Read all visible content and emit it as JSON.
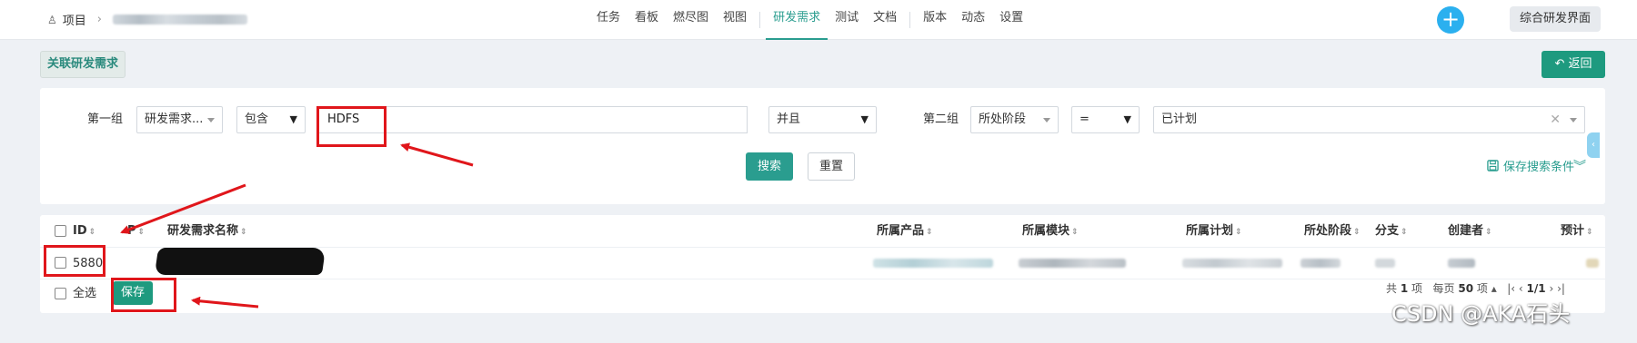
{
  "topnav": {
    "project_label": "项目",
    "items": [
      "任务",
      "看板",
      "燃尽图",
      "视图",
      "研发需求",
      "测试",
      "文档",
      "版本",
      "动态",
      "设置"
    ],
    "active_item": "研发需求",
    "right_button": "综合研发界面"
  },
  "subheader": {
    "tag": "关联研发需求",
    "back_button": "返回"
  },
  "search": {
    "group1_label": "第一组",
    "group1_field": "研发需求...",
    "group1_operator": "包含",
    "group1_value": "HDFS",
    "logic": "并且",
    "group2_label": "第二组",
    "group2_field": "所处阶段",
    "group2_operator": "=",
    "group2_value": "已计划",
    "search_button": "搜索",
    "reset_button": "重置",
    "save_search": "保存搜索条件"
  },
  "table": {
    "headers": [
      "ID",
      "P",
      "研发需求名称",
      "所属产品",
      "所属模块",
      "所属计划",
      "所处阶段",
      "分支",
      "创建者",
      "预计"
    ],
    "rows": [
      {
        "id": "5880"
      }
    ],
    "select_all": "全选",
    "save_button": "保存"
  },
  "pager": {
    "total_prefix": "共",
    "total": "1",
    "total_unit": "项",
    "per_page_prefix": "每页",
    "per_page": "50",
    "per_page_unit": "项",
    "page": "1/1"
  },
  "watermark": "CSDN @AKA石头",
  "colors": {
    "accent": "#2a9d8f",
    "primary_button": "#1e9a7f",
    "annotation_red": "#e0161b",
    "plus_button": "#2bb0ef"
  }
}
